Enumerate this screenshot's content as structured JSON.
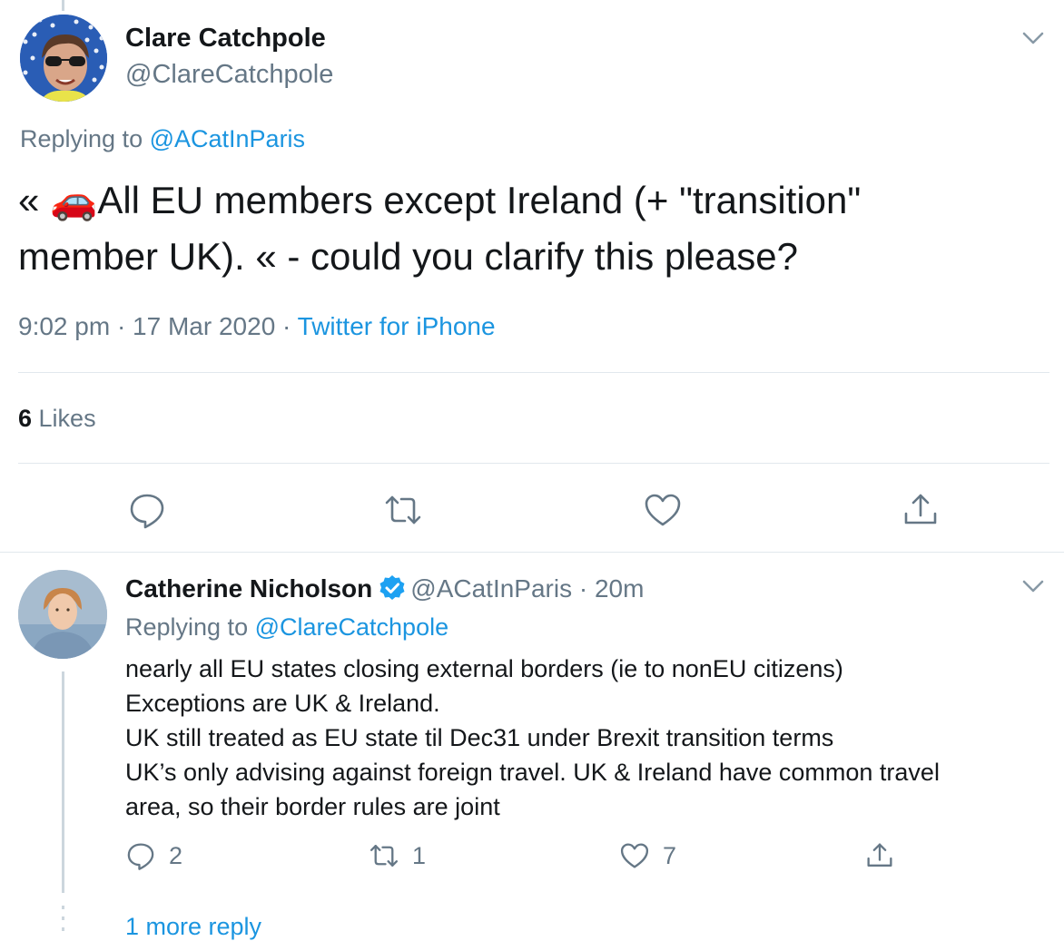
{
  "tweet": {
    "author_name": "Clare Catchpole",
    "author_handle": "@ClareCatchpole",
    "replying_prefix": "Replying to ",
    "replying_to": "@ACatInParis",
    "text_line1": "« 🚗All EU members except Ireland (+ \"transition\"",
    "text_line2": "member UK). « - could you clarify this please?",
    "time": "9:02 pm · 17 Mar 2020 · ",
    "source": "Twitter for iPhone",
    "likes_count": "6",
    "likes_label": " Likes"
  },
  "reply": {
    "author_name": "Catherine Nicholson",
    "author_handle": "@ACatInParis",
    "time_sep": " · ",
    "time": "20m",
    "replying_prefix": "Replying to ",
    "replying_to": "@ClareCatchpole",
    "lines": [
      "nearly all EU states closing external borders (ie to nonEU citizens)",
      "Exceptions are UK & Ireland.",
      "UK still treated as EU state til Dec31 under Brexit transition terms",
      "UK’s only advising against foreign travel. UK & Ireland have common travel",
      "area, so their border rules are joint"
    ],
    "reply_count": "2",
    "retweet_count": "1",
    "like_count": "7"
  },
  "more_replies": "1 more reply",
  "colors": {
    "link": "#1b95e0",
    "secondary": "#657786",
    "divider": "#e1e8ed",
    "verified": "#1da1f2"
  },
  "icons": [
    "chevron-down-icon",
    "reply-icon",
    "retweet-icon",
    "like-icon",
    "share-icon",
    "verified-badge-icon"
  ]
}
